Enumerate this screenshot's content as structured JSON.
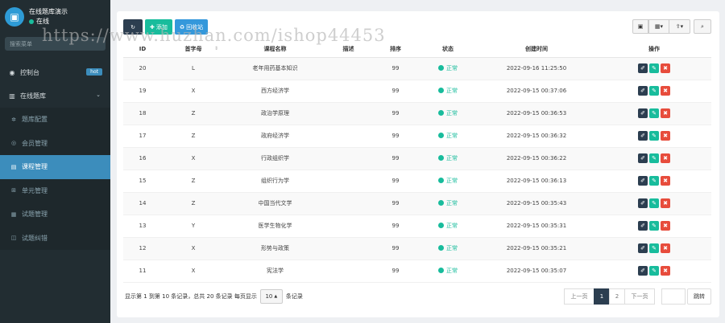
{
  "sidebar": {
    "title": "在线题库演示",
    "status": "在线",
    "search_placeholder": "搜索菜单",
    "items": [
      {
        "label": "控制台",
        "badge": "hot"
      },
      {
        "label": "在线题库"
      }
    ],
    "subitems": [
      {
        "label": "题库配置"
      },
      {
        "label": "会员管理"
      },
      {
        "label": "课程管理"
      },
      {
        "label": "单元管理"
      },
      {
        "label": "试题管理"
      },
      {
        "label": "试题纠错"
      }
    ]
  },
  "toolbar": {
    "add_label": "添加",
    "recycle_label": "回收站"
  },
  "table": {
    "headers": [
      "ID",
      "首字母",
      "课程名称",
      "描述",
      "排序",
      "状态",
      "创建时间",
      "操作"
    ],
    "status_label": "正常",
    "rows": [
      {
        "id": "20",
        "letter": "L",
        "name": "老年用药基本知识",
        "desc": "",
        "sort": "99",
        "time": "2022-09-16 11:25:50"
      },
      {
        "id": "19",
        "letter": "X",
        "name": "西方经济学",
        "desc": "",
        "sort": "99",
        "time": "2022-09-15 00:37:06"
      },
      {
        "id": "18",
        "letter": "Z",
        "name": "政治学原理",
        "desc": "",
        "sort": "99",
        "time": "2022-09-15 00:36:53"
      },
      {
        "id": "17",
        "letter": "Z",
        "name": "政府经济学",
        "desc": "",
        "sort": "99",
        "time": "2022-09-15 00:36:32"
      },
      {
        "id": "16",
        "letter": "X",
        "name": "行政组织学",
        "desc": "",
        "sort": "99",
        "time": "2022-09-15 00:36:22"
      },
      {
        "id": "15",
        "letter": "Z",
        "name": "组织行为学",
        "desc": "",
        "sort": "99",
        "time": "2022-09-15 00:36:13"
      },
      {
        "id": "14",
        "letter": "Z",
        "name": "中国当代文学",
        "desc": "",
        "sort": "99",
        "time": "2022-09-15 00:35:43"
      },
      {
        "id": "13",
        "letter": "Y",
        "name": "医学生物化学",
        "desc": "",
        "sort": "99",
        "time": "2022-09-15 00:35:31"
      },
      {
        "id": "12",
        "letter": "X",
        "name": "形势与政策",
        "desc": "",
        "sort": "99",
        "time": "2022-09-15 00:35:21"
      },
      {
        "id": "11",
        "letter": "X",
        "name": "宪法学",
        "desc": "",
        "sort": "99",
        "time": "2022-09-15 00:35:07"
      }
    ]
  },
  "footer": {
    "info_prefix": "显示第 1 到第 10 条记录，总共 20 条记录 每页显示",
    "per_page": "10",
    "info_suffix": "条记录",
    "prev": "上一页",
    "pages": [
      "1",
      "2"
    ],
    "next": "下一页",
    "jump": "跳转"
  },
  "watermark": "https://www.huzhan.com/ishop44453",
  "colors": {
    "sidebar_bg": "#222d32",
    "active": "#3c8dbc",
    "success": "#18bc9c",
    "danger": "#e74c3c",
    "dark": "#2c3e50",
    "info": "#3498db"
  }
}
